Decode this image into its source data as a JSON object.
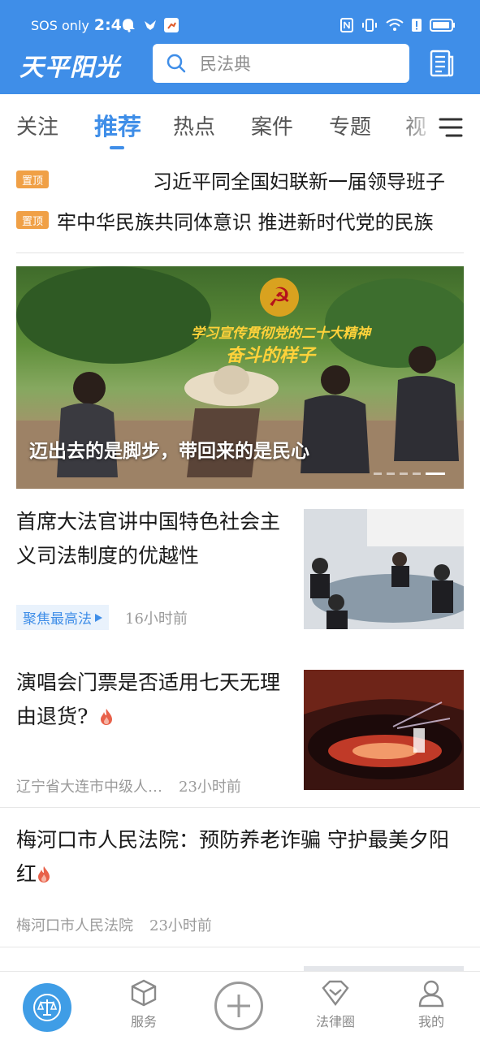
{
  "status_bar": {
    "carrier": "SOS only",
    "time": "2:46"
  },
  "header": {
    "logo": "天平阳光",
    "search_placeholder": "民法典"
  },
  "tabs": [
    {
      "label": "关注"
    },
    {
      "label": "推荐",
      "active": true
    },
    {
      "label": "热点"
    },
    {
      "label": "案件"
    },
    {
      "label": "专题"
    },
    {
      "label": "视"
    }
  ],
  "pinned": [
    {
      "badge": "置顶",
      "text": "习近平同全国妇联新一届领导班子"
    },
    {
      "badge": "置顶",
      "text": "牢中华民族共同体意识  推进新时代党的民族"
    }
  ],
  "banner": {
    "subtitle": "学习宣传贯彻党的二十大精神",
    "slogan": "奋斗的样子",
    "caption": "迈出去的是脚步，带回来的是民心",
    "slides": 5,
    "active_slide": 5
  },
  "news": [
    {
      "title": "首席大法官讲中国特色社会主义司法制度的优越性",
      "tag": "聚焦最高法",
      "time": "16小时前"
    },
    {
      "title": "演唱会门票是否适用七天无理由退货?",
      "source": "辽宁省大连市中级人…",
      "time": "23小时前"
    },
    {
      "title": "梅河口市人民法院：预防养老诈骗  守护最美夕阳红",
      "source": "梅河口市人民法院",
      "time": "23小时前"
    }
  ],
  "bottom_nav": {
    "service": "服务",
    "law_circle": "法律圈",
    "mine": "我的"
  },
  "colors": {
    "primary": "#3f8ee8",
    "pin_badge": "#f0a046"
  }
}
